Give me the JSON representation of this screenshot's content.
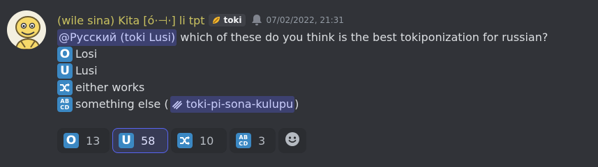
{
  "message": {
    "author": "(wile sina) Kita [ó·⊣·] li tpt",
    "tag": {
      "icon": "leaf-icon",
      "label": "toki"
    },
    "timestamp": "07/02/2022, 21:31",
    "mention": "@Русский (toki Lusi)",
    "text": " which of these do you think is the best tokiponization for russian?",
    "options": [
      {
        "emoji": "O",
        "label": "Losi"
      },
      {
        "emoji": "U",
        "label": "Lusi"
      },
      {
        "emoji": "twisted-arrows-icon",
        "label": "either works"
      }
    ],
    "last_option": {
      "emoji": "ABCD",
      "prefix": "something else (",
      "channel": "toki-pi-sona-kulupu",
      "suffix": ")"
    }
  },
  "reactions": [
    {
      "emoji": "O",
      "count": "13",
      "active": false
    },
    {
      "emoji": "U",
      "count": "58",
      "active": true
    },
    {
      "emoji": "twisted-arrows-icon",
      "count": "10",
      "active": false
    },
    {
      "emoji": "ABCD",
      "count": "3",
      "active": false
    }
  ],
  "colors": {
    "background": "#313338",
    "username": "#c9c160",
    "mention_bg": "#3c4270",
    "mention_text": "#c9cdfb",
    "emoji_blue": "#3b88c3",
    "active_reaction_border": "#5865f2",
    "timestamp": "#949ba4"
  }
}
